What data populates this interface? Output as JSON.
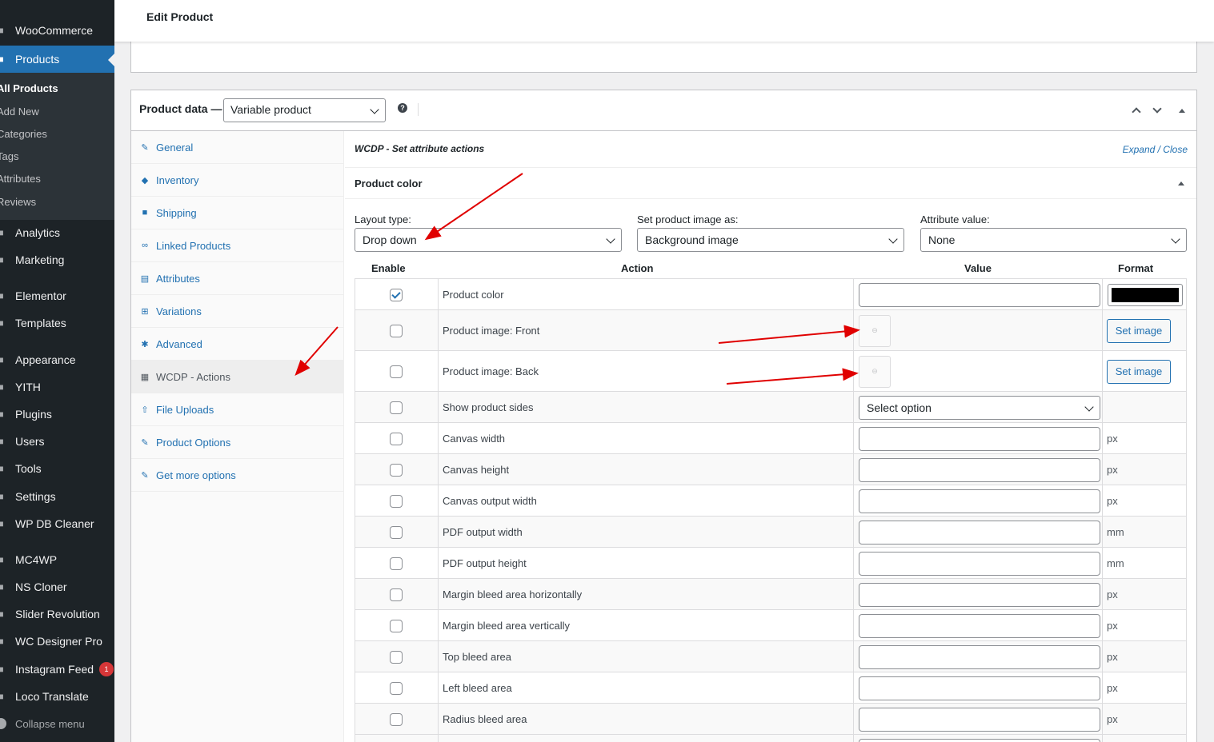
{
  "sidebar": {
    "items": [
      {
        "label": "WooCommerce",
        "icon": "woo-icon"
      },
      {
        "label": "Products",
        "icon": "products-icon"
      },
      {
        "label": "Analytics",
        "icon": "analytics-icon"
      },
      {
        "label": "Marketing",
        "icon": "marketing-icon"
      },
      {
        "label": "Elementor",
        "icon": "elementor-icon"
      },
      {
        "label": "Templates",
        "icon": "templates-icon"
      },
      {
        "label": "Appearance",
        "icon": "appearance-icon"
      },
      {
        "label": "YITH",
        "icon": "yith-icon"
      },
      {
        "label": "Plugins",
        "icon": "plugins-icon"
      },
      {
        "label": "Users",
        "icon": "users-icon"
      },
      {
        "label": "Tools",
        "icon": "tools-icon"
      },
      {
        "label": "Settings",
        "icon": "settings-icon"
      },
      {
        "label": "WP DB Cleaner",
        "icon": "db-cleaner-icon"
      },
      {
        "label": "MC4WP",
        "icon": "mc4wp-icon"
      },
      {
        "label": "NS Cloner",
        "icon": "ns-cloner-icon"
      },
      {
        "label": "Slider Revolution",
        "icon": "slider-icon"
      },
      {
        "label": "WC Designer Pro",
        "icon": "designer-icon"
      },
      {
        "label": "Instagram Feed",
        "icon": "instagram-icon",
        "badge": "1"
      },
      {
        "label": "Loco Translate",
        "icon": "translate-icon"
      }
    ],
    "submenu": [
      "All Products",
      "Add New",
      "Categories",
      "Tags",
      "Attributes",
      "Reviews"
    ],
    "collapse_label": "Collapse menu"
  },
  "header": {
    "title": "Edit Product"
  },
  "product_data": {
    "label": "Product data —",
    "type_value": "Variable product",
    "help": "?"
  },
  "tabs": [
    {
      "label": "General",
      "icon": "wrench-icon"
    },
    {
      "label": "Inventory",
      "icon": "tag-icon"
    },
    {
      "label": "Shipping",
      "icon": "truck-icon"
    },
    {
      "label": "Linked Products",
      "icon": "link-icon"
    },
    {
      "label": "Attributes",
      "icon": "list-icon"
    },
    {
      "label": "Variations",
      "icon": "grid-icon"
    },
    {
      "label": "Advanced",
      "icon": "gear-icon"
    },
    {
      "label": "WCDP - Actions",
      "icon": "actions-icon"
    },
    {
      "label": "File Uploads",
      "icon": "upload-icon"
    },
    {
      "label": "Product Options",
      "icon": "wrench-icon"
    },
    {
      "label": "Get more options",
      "icon": "plugin-icon"
    }
  ],
  "panel": {
    "title": "WCDP - Set attribute actions",
    "expand_close": "Expand / Close",
    "attribute": "Product color",
    "layout_label": "Layout type:",
    "layout_value": "Drop down",
    "image_label": "Set product image as:",
    "image_value": "Background image",
    "attr_label": "Attribute value:",
    "attr_value": "None"
  },
  "table": {
    "headers": {
      "enable": "Enable",
      "action": "Action",
      "value": "Value",
      "format": "Format"
    },
    "rows": [
      {
        "action": "Product color",
        "checked": true,
        "kind": "color",
        "unit": ""
      },
      {
        "action": "Product image: Front",
        "checked": false,
        "kind": "image",
        "button": "Set image"
      },
      {
        "action": "Product image: Back",
        "checked": false,
        "kind": "image",
        "button": "Set image"
      },
      {
        "action": "Show product sides",
        "checked": false,
        "kind": "select",
        "value": "Select option"
      },
      {
        "action": "Canvas width",
        "checked": false,
        "kind": "input",
        "unit": "px"
      },
      {
        "action": "Canvas height",
        "checked": false,
        "kind": "input",
        "unit": "px"
      },
      {
        "action": "Canvas output width",
        "checked": false,
        "kind": "input",
        "unit": "px"
      },
      {
        "action": "PDF output width",
        "checked": false,
        "kind": "input",
        "unit": "mm"
      },
      {
        "action": "PDF output height",
        "checked": false,
        "kind": "input",
        "unit": "mm"
      },
      {
        "action": "Margin bleed area horizontally",
        "checked": false,
        "kind": "input",
        "unit": "px"
      },
      {
        "action": "Margin bleed area vertically",
        "checked": false,
        "kind": "input",
        "unit": "px"
      },
      {
        "action": "Top bleed area",
        "checked": false,
        "kind": "input",
        "unit": "px"
      },
      {
        "action": "Left bleed area",
        "checked": false,
        "kind": "input",
        "unit": "px"
      },
      {
        "action": "Radius bleed area",
        "checked": false,
        "kind": "input",
        "unit": "px"
      }
    ]
  },
  "colors": {
    "sidebar": "#1d2327",
    "accent": "#2271b1",
    "annotation": "#e00000",
    "swatch": "#000000"
  }
}
